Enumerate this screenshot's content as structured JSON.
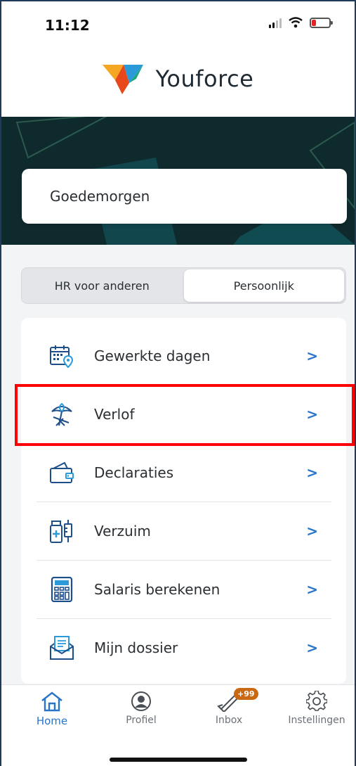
{
  "status_bar": {
    "time": "11:12"
  },
  "app": {
    "name": "Youforce"
  },
  "greeting": "Goedemorgen",
  "segments": [
    {
      "label": "HR voor anderen",
      "active": false
    },
    {
      "label": "Persoonlijk",
      "active": true
    }
  ],
  "menu": [
    {
      "label": "Gewerkte dagen",
      "icon": "calendar-location-icon"
    },
    {
      "label": "Verlof",
      "icon": "beach-umbrella-icon"
    },
    {
      "label": "Declaraties",
      "icon": "wallet-icon"
    },
    {
      "label": "Verzuim",
      "icon": "medicine-icon"
    },
    {
      "label": "Salaris berekenen",
      "icon": "calculator-icon"
    },
    {
      "label": "Mijn dossier",
      "icon": "document-envelope-icon"
    }
  ],
  "chevron": ">",
  "tabs": [
    {
      "label": "Home",
      "icon": "home-icon",
      "active": true
    },
    {
      "label": "Profiel",
      "icon": "profile-icon",
      "active": false
    },
    {
      "label": "Inbox",
      "icon": "megaphone-icon",
      "active": false,
      "badge": "+99"
    },
    {
      "label": "Instellingen",
      "icon": "gear-icon",
      "active": false
    }
  ],
  "colors": {
    "accent": "#2a74c9",
    "band": "#0f2a2d",
    "badge": "#c96a12",
    "highlight": "#ff0000"
  }
}
